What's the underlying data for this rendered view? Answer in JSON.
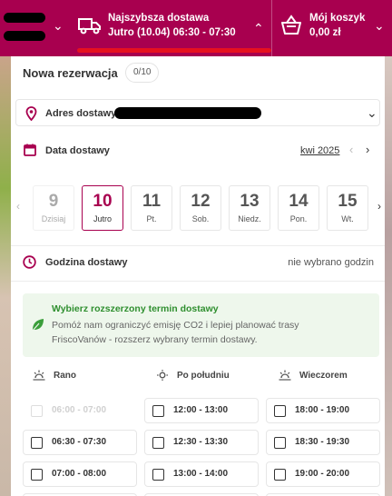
{
  "header": {
    "delivery_title": "Najszybsza dostawa",
    "delivery_subtitle": "Jutro (10.04) 06:30 - 07:30",
    "cart_title": "Mój koszyk",
    "cart_amount": "0,00 zł",
    "accent_color": "#a8004f",
    "underline_color": "#e6111f"
  },
  "reservation": {
    "title": "Nowa rezerwacja",
    "count": "0/10"
  },
  "address": {
    "label": "Adres dostawy"
  },
  "date": {
    "label": "Data dostawy",
    "month": "kwi 2025",
    "days": [
      {
        "num": "9",
        "name": "Dzisiaj",
        "state": "dim"
      },
      {
        "num": "10",
        "name": "Jutro",
        "state": "selected"
      },
      {
        "num": "11",
        "name": "Pt.",
        "state": "normal"
      },
      {
        "num": "12",
        "name": "Sob.",
        "state": "normal"
      },
      {
        "num": "13",
        "name": "Niedz.",
        "state": "normal"
      },
      {
        "num": "14",
        "name": "Pon.",
        "state": "normal"
      },
      {
        "num": "15",
        "name": "Wt.",
        "state": "normal"
      }
    ]
  },
  "hours": {
    "label": "Godzina dostawy",
    "value": "nie wybrano godzin"
  },
  "eco": {
    "title": "Wybierz rozszerzony termin dostawy",
    "desc_line1": "Pomóż nam ograniczyć emisję CO2 i lepiej planować trasy",
    "desc_line2": "FriscoVanów - rozszerz wybrany termin dostawy."
  },
  "periods": {
    "morning": "Rano",
    "afternoon": "Po południu",
    "evening": "Wieczorem"
  },
  "slots": {
    "morning": [
      "06:00 - 07:00",
      "06:30 - 07:30",
      "07:00 - 08:00"
    ],
    "afternoon": [
      "12:00 - 13:00",
      "12:30 - 13:30",
      "13:00 - 14:00"
    ],
    "evening": [
      "18:00 - 19:00",
      "18:30 - 19:30",
      "19:00 - 20:00"
    ]
  },
  "icons": [
    "truck-icon",
    "basket-icon",
    "chevron-down-icon",
    "chevron-up-icon",
    "location-pin-icon",
    "calendar-icon",
    "clock-icon",
    "leaf-icon",
    "sunrise-icon",
    "sun-icon",
    "sunset-icon"
  ]
}
